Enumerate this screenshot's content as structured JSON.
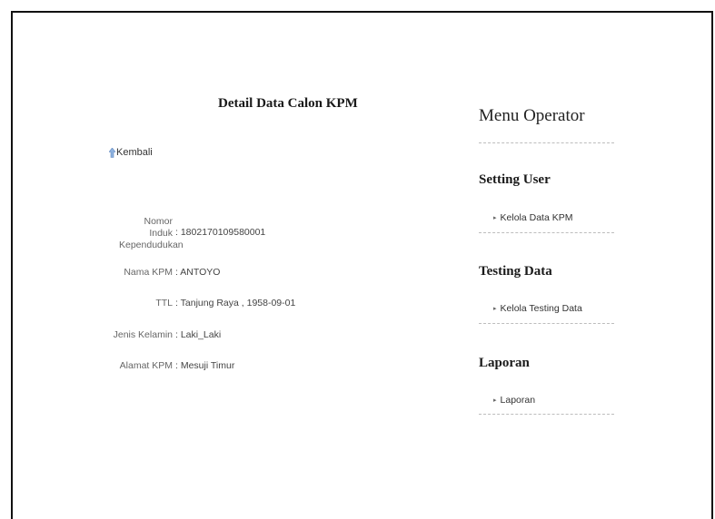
{
  "detail": {
    "title": "Detail Data Calon KPM",
    "back_label": "Kembali",
    "fields": [
      {
        "label": "Nomor Induk Kependudukan",
        "value": ": 1802170109580001"
      },
      {
        "label": "Nama KPM",
        "value": ": ANTOYO"
      },
      {
        "label": "TTL",
        "value": ": Tanjung Raya , 1958-09-01"
      },
      {
        "label": "Jenis Kelamin",
        "value": ": Laki_Laki"
      },
      {
        "label": "Alamat KPM",
        "value": ": Mesuji Timur"
      }
    ]
  },
  "menu": {
    "title": "Menu Operator",
    "sections": [
      {
        "title": "Setting User",
        "item": "Kelola Data KPM"
      },
      {
        "title": "Testing Data",
        "item": "Kelola Testing Data"
      },
      {
        "title": "Laporan",
        "item": "Laporan"
      }
    ]
  },
  "colors": {
    "back_arrow": "#8fb3e0",
    "separator": "#bdbdbd"
  }
}
